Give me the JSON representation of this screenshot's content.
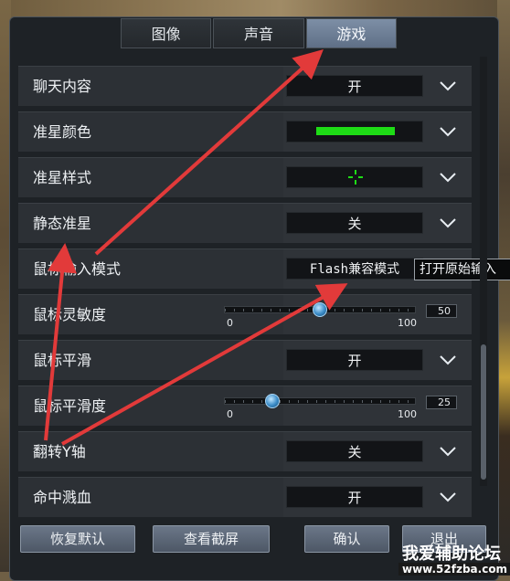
{
  "tabs": [
    "图像",
    "声音",
    "游戏"
  ],
  "active_tab": "游戏",
  "settings": [
    {
      "label": "聊天内容",
      "type": "dropdown",
      "value": "开"
    },
    {
      "label": "准星颜色",
      "type": "color",
      "value": "",
      "color": "#1edc16"
    },
    {
      "label": "准星样式",
      "type": "crosshair",
      "value": ""
    },
    {
      "label": "静态准星",
      "type": "dropdown",
      "value": "关"
    },
    {
      "label": "鼠标输入模式",
      "type": "text",
      "value": "Flash兼容模式"
    },
    {
      "label": "鼠标灵敏度",
      "type": "slider",
      "min": "0",
      "max": "100",
      "value": "50"
    },
    {
      "label": "鼠标平滑",
      "type": "dropdown",
      "value": "开"
    },
    {
      "label": "鼠标平滑度",
      "type": "slider",
      "min": "0",
      "max": "100",
      "value": "25"
    },
    {
      "label": "翻转Y轴",
      "type": "dropdown",
      "value": "关"
    },
    {
      "label": "命中溅血",
      "type": "dropdown",
      "value": "开"
    }
  ],
  "tooltip": "打开原始输入",
  "buttons": {
    "reset": "恢复默认",
    "screenshot": "查看截屏",
    "confirm": "确认",
    "exit": "退出"
  },
  "watermark": {
    "title": "我爱辅助论坛",
    "url": "www.52fzba.com"
  },
  "colors": {
    "arrow": "#e23a3a",
    "accent_tab": "#6f819a",
    "crosshair": "#1edc16"
  }
}
